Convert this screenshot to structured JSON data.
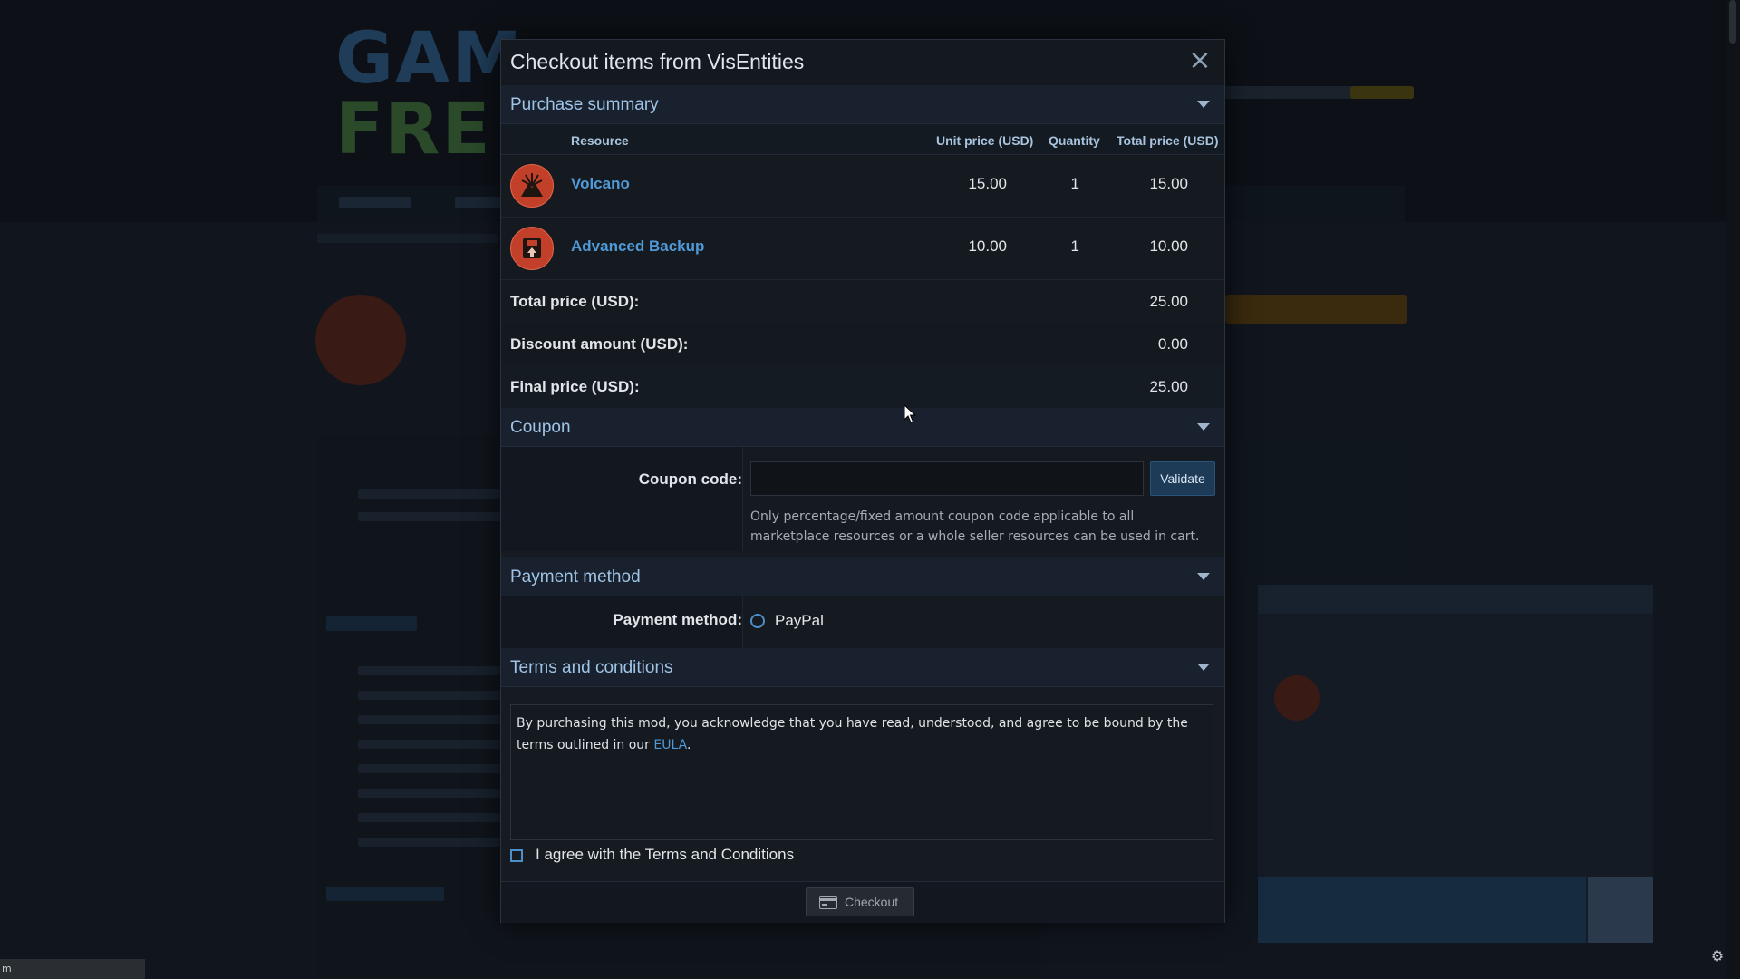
{
  "modal": {
    "title": "Checkout items from VisEntities"
  },
  "summary": {
    "section_label": "Purchase summary",
    "columns": {
      "resource": "Resource",
      "unit_price": "Unit price (USD)",
      "quantity": "Quantity",
      "total_price": "Total price (USD)"
    },
    "items": [
      {
        "name": "Volcano",
        "icon": "volcano-icon",
        "unit_price": "15.00",
        "quantity": "1",
        "total": "15.00"
      },
      {
        "name": "Advanced Backup",
        "icon": "backup-icon",
        "unit_price": "10.00",
        "quantity": "1",
        "total": "10.00"
      }
    ],
    "total_label": "Total price (USD):",
    "total_value": "25.00",
    "discount_label": "Discount amount (USD):",
    "discount_value": "0.00",
    "final_label": "Final price (USD):",
    "final_value": "25.00"
  },
  "coupon": {
    "section_label": "Coupon",
    "field_label": "Coupon code:",
    "value": "",
    "validate_label": "Validate",
    "help_text": "Only percentage/fixed amount coupon code applicable to all marketplace resources or a whole seller resources can be used in cart."
  },
  "payment": {
    "section_label": "Payment method",
    "field_label": "Payment method:",
    "option": "PayPal"
  },
  "terms": {
    "section_label": "Terms and conditions",
    "text_before": "By purchasing this mod, you acknowledge that you have read, understood, and agree to be bound by the terms outlined in our ",
    "link": "EULA",
    "text_after": ".",
    "agree_label": "I agree with the Terms and Conditions"
  },
  "footer": {
    "checkout_label": "Checkout"
  },
  "status_bar": {
    "text": "m"
  },
  "colors": {
    "accent": "#4f9ad6",
    "item_icon": "#c2402a",
    "section_text": "#9fc4e6"
  }
}
